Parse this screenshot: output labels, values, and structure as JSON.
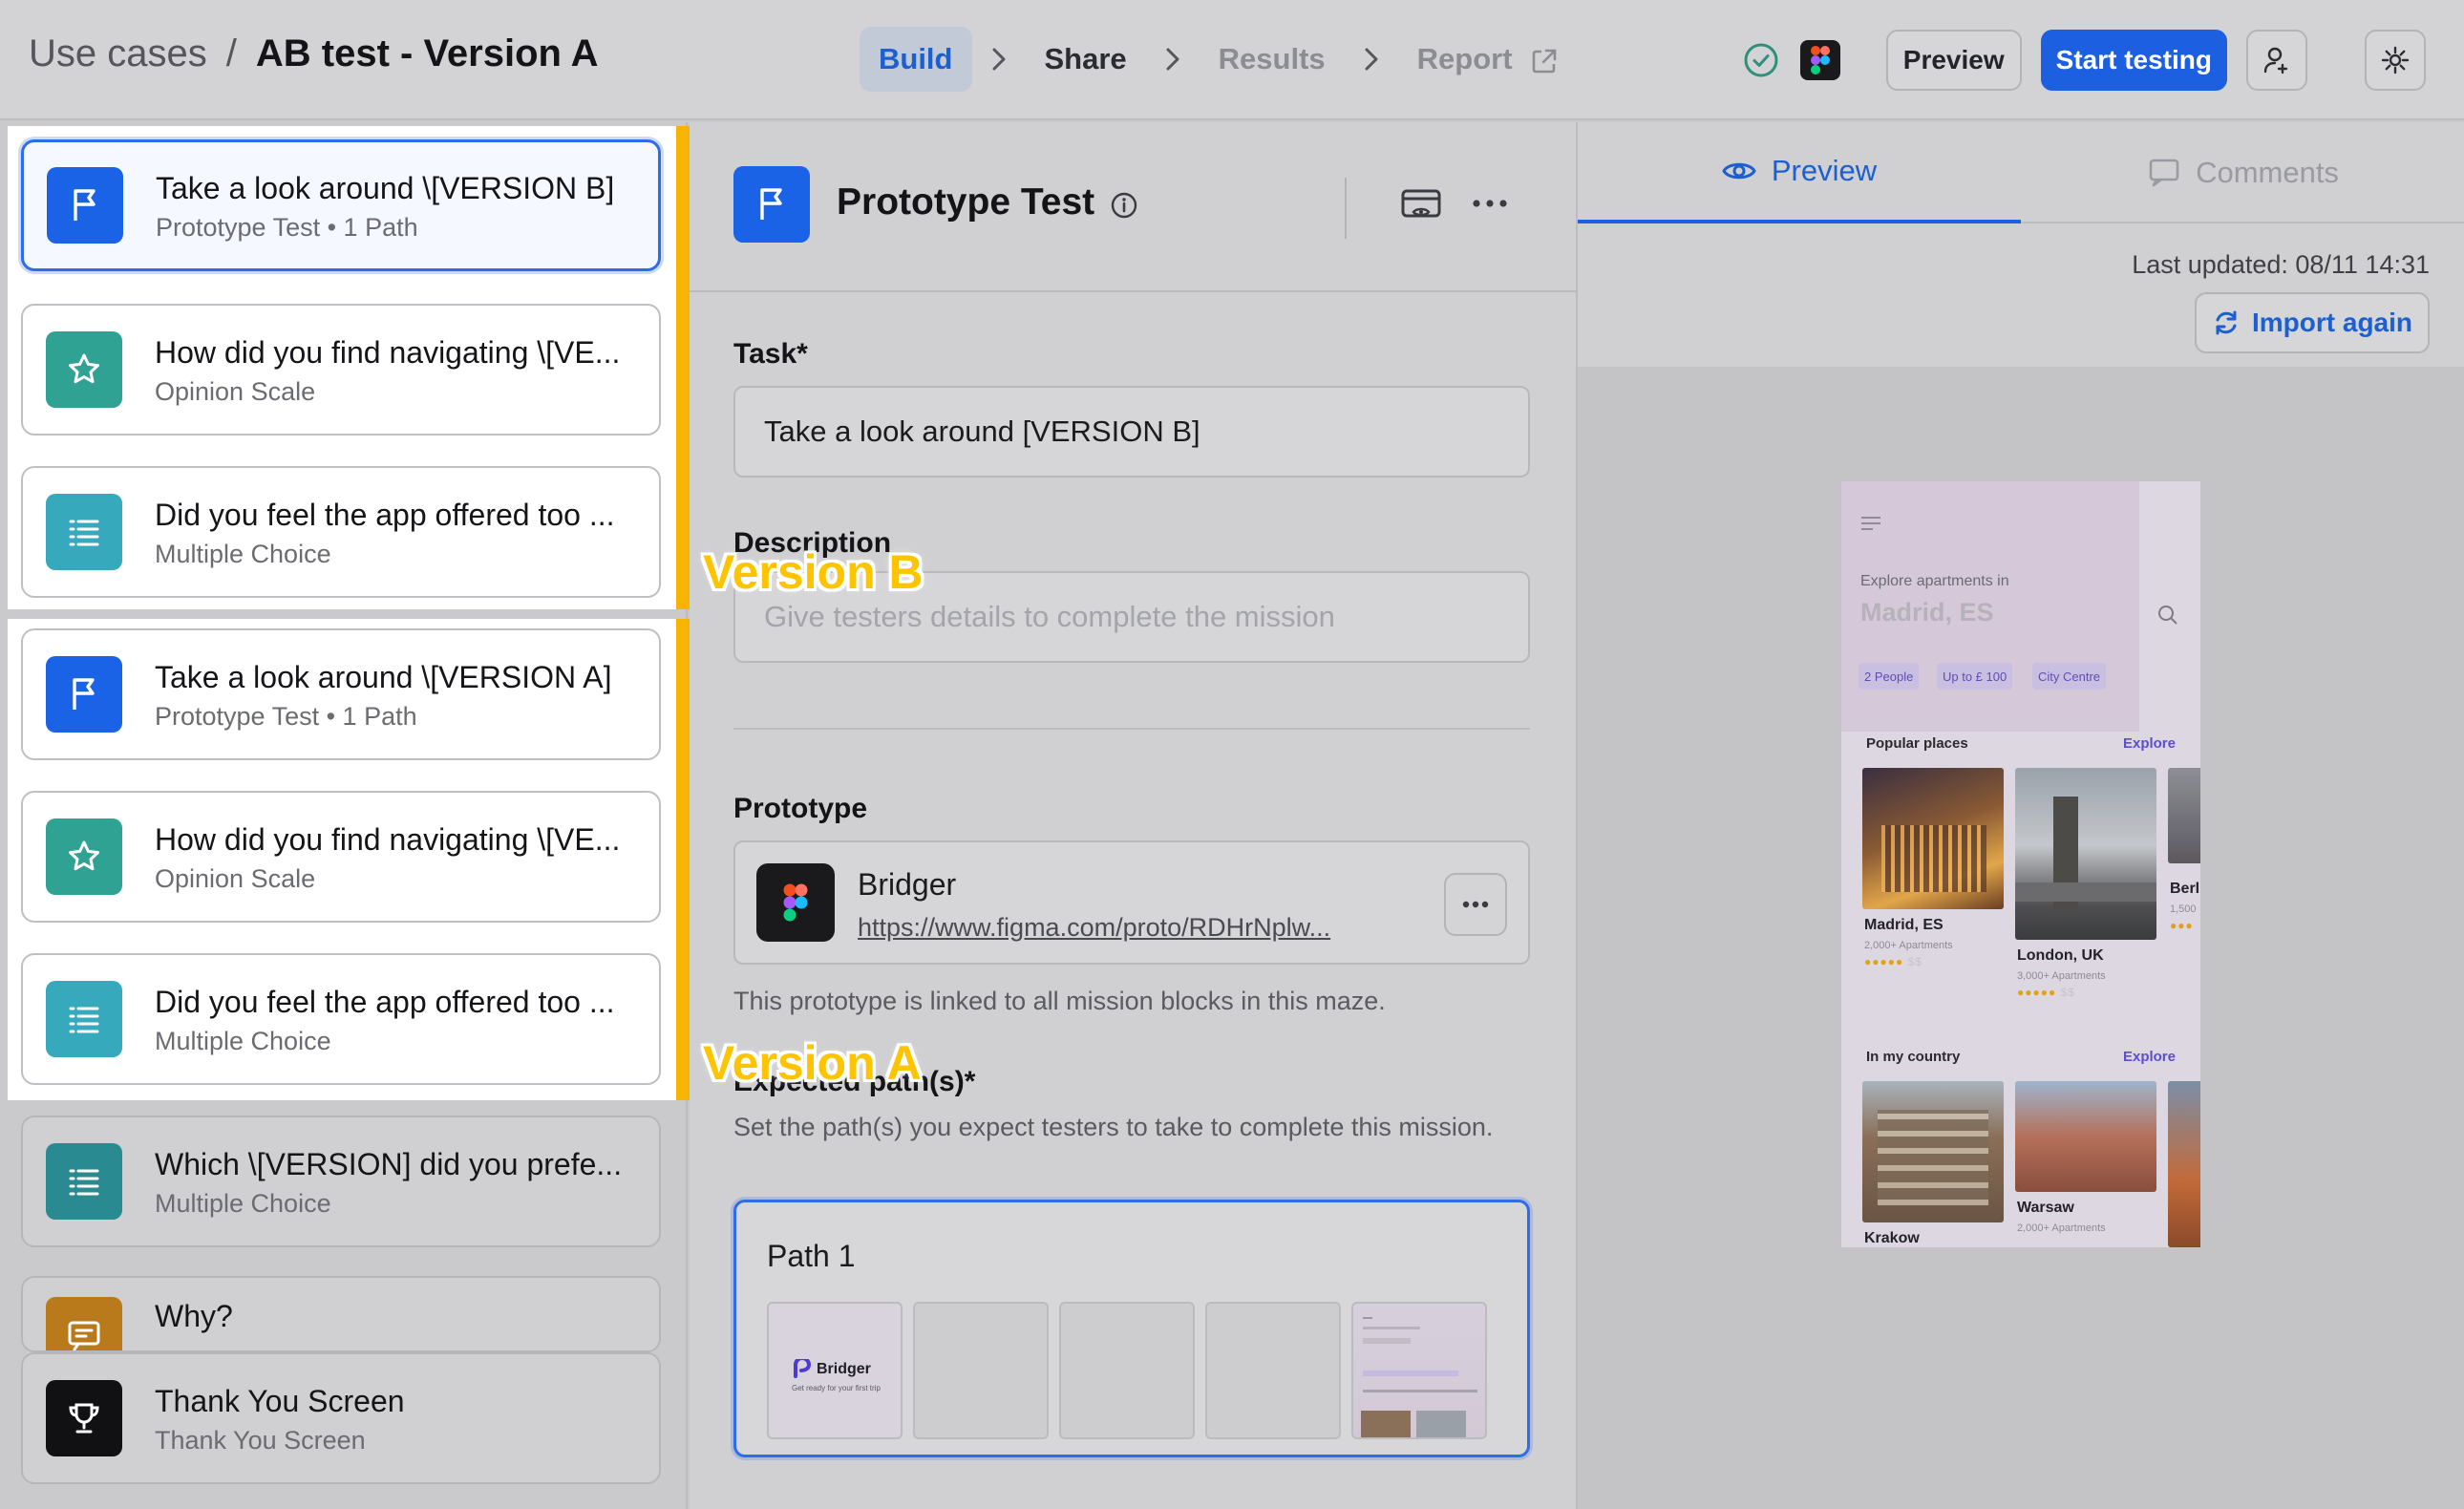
{
  "breadcrumb": {
    "parent": "Use cases",
    "separator": "/",
    "current": "AB test - Version A"
  },
  "steps": [
    {
      "label": "Build",
      "state": "active"
    },
    {
      "label": "Share",
      "state": "normal"
    },
    {
      "label": "Results",
      "state": "muted"
    },
    {
      "label": "Report",
      "state": "muted"
    }
  ],
  "toolbar": {
    "preview_label": "Preview",
    "start_label": "Start testing"
  },
  "blocks": [
    {
      "title": "Take a look around \\[VERSION B]",
      "subtitle": "Prototype Test • 1 Path",
      "icon": "flag-icon",
      "color": "#1a63e6",
      "state": "selected"
    },
    {
      "title": "How did you find navigating \\[VE...",
      "subtitle": "Opinion Scale",
      "icon": "star-icon",
      "color": "#2fa294"
    },
    {
      "title": "Did you feel the app offered too ...",
      "subtitle": "Multiple Choice",
      "icon": "list-icon",
      "color": "#36a9bd"
    },
    {
      "title": "Take a look around \\[VERSION A]",
      "subtitle": "Prototype Test • 1 Path",
      "icon": "flag-icon",
      "color": "#1a63e6"
    },
    {
      "title": "How did you find navigating \\[VE...",
      "subtitle": "Opinion Scale",
      "icon": "star-icon",
      "color": "#2fa294"
    },
    {
      "title": "Did you feel the app offered too ...",
      "subtitle": "Multiple Choice",
      "icon": "list-icon",
      "color": "#36a9bd"
    },
    {
      "title": "Which \\[VERSION] did you prefe...",
      "subtitle": "Multiple Choice",
      "icon": "list-icon",
      "color": "#2a8a92"
    },
    {
      "title": "Why?",
      "subtitle": "",
      "icon": "comment-icon",
      "color": "#b97a1b"
    },
    {
      "title": "Thank You Screen",
      "subtitle": "Thank You Screen",
      "icon": "trophy-icon",
      "color": "#111113"
    }
  ],
  "annotations": {
    "version_b": "Version B",
    "version_a": "Version A"
  },
  "editor": {
    "title": "Prototype Test",
    "task_label": "Task*",
    "task_value": "Take a look around [VERSION B]",
    "description_label": "Description",
    "description_placeholder": "Give testers details to complete the mission",
    "prototype_label": "Prototype",
    "prototype_name": "Bridger",
    "prototype_url": "https://www.figma.com/proto/RDHrNplw...",
    "prototype_note": "This prototype is linked to all mission blocks in this maze.",
    "paths_label": "Expected path(s)*",
    "paths_help": "Set the path(s) you expect testers to take to complete this mission.",
    "path_title": "Path 1",
    "thumb_brand": "Bridger",
    "thumb_tagline": "Get ready for your first trip"
  },
  "right_panel": {
    "tab_preview": "Preview",
    "tab_comments": "Comments",
    "last_updated": "Last updated: 08/11 14:31",
    "import_label": "Import again"
  },
  "phone": {
    "explore_text": "Explore apartments in",
    "city": "Madrid, ES",
    "chips": [
      "2 People",
      "Up to £ 100",
      "City Centre"
    ],
    "popular_title": "Popular places",
    "explore_link": "Explore",
    "places": [
      {
        "name": "Madrid, ES",
        "count": "2,000+ Apartments"
      },
      {
        "name": "London, UK",
        "count": "3,000+ Apartments"
      },
      {
        "name": "Berl",
        "count": "1,500"
      }
    ],
    "country_title": "In my country",
    "country_places": [
      {
        "name": "Krakow",
        "count": ""
      },
      {
        "name": "Warsaw",
        "count": "2,000+ Apartments"
      }
    ]
  },
  "colors": {
    "accent": "#1c5fe0",
    "annotation": "#f6b400",
    "success": "#2f8f7a"
  }
}
